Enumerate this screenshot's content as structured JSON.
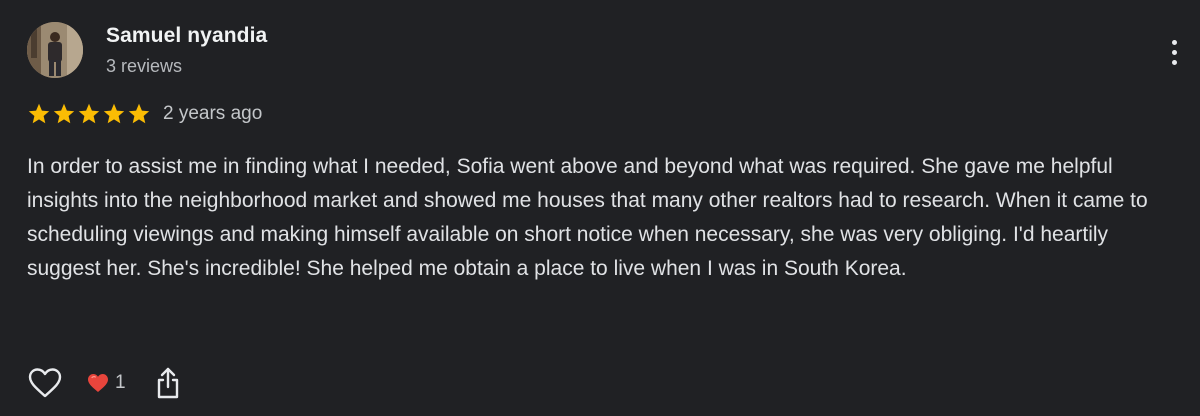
{
  "reviewer": {
    "name": "Samuel nyandia",
    "meta": "3 reviews",
    "avatar": "user-photo"
  },
  "review": {
    "rating": 5,
    "rating_max": 5,
    "time": "2 years ago",
    "text": "In order to assist me in finding what I needed, Sofia went above and beyond what was required. She gave me helpful insights into the neighborhood market and showed me houses that many other realtors had to research. When it came to scheduling viewings and making himself available on short notice when necessary, she was very obliging. I'd heartily suggest her. She's incredible! She helped me obtain a place to live when I was in South Korea."
  },
  "actions": {
    "like_icon": "heart-outline-icon",
    "reaction_icon": "red-heart-icon",
    "reaction_count": "1",
    "share_icon": "share-icon",
    "more_icon": "more-vertical-icon"
  },
  "colors": {
    "background": "#202124",
    "star": "#fbbc04",
    "heart": "#e8453c",
    "text": "#e8eaed"
  }
}
